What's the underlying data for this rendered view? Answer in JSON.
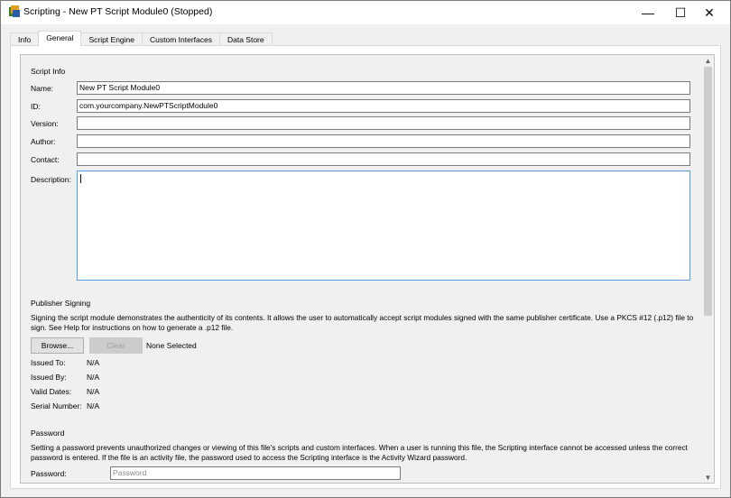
{
  "window": {
    "title": "Scripting - New PT Script Module0 (Stopped)",
    "controls": {
      "minimize": "—",
      "maximize": "☐",
      "close": "✕"
    }
  },
  "tabs": [
    {
      "label": "Info",
      "active": false
    },
    {
      "label": "General",
      "active": true
    },
    {
      "label": "Script Engine",
      "active": false
    },
    {
      "label": "Custom Interfaces",
      "active": false
    },
    {
      "label": "Data Store",
      "active": false
    }
  ],
  "script_info": {
    "heading": "Script Info",
    "name": {
      "label": "Name:",
      "value": "New PT Script Module0"
    },
    "id": {
      "label": "ID:",
      "value": "com.yourcompany.NewPTScriptModule0"
    },
    "version": {
      "label": "Version:",
      "value": ""
    },
    "author": {
      "label": "Author:",
      "value": ""
    },
    "contact": {
      "label": "Contact:",
      "value": ""
    },
    "description": {
      "label": "Description:",
      "value": ""
    }
  },
  "publisher_signing": {
    "heading": "Publisher Signing",
    "text": "Signing the script module demonstrates the authenticity of its contents. It allows the user to automatically accept script modules signed with the same publisher certificate. Use a PKCS #12 (.p12) file to sign. See Help for instructions on how to generate a .p12 file.",
    "browse_label": "Browse...",
    "clear_label": "Clear",
    "selected_text": "None Selected",
    "issued_to": {
      "label": "Issued To:",
      "value": "N/A"
    },
    "issued_by": {
      "label": "Issued By:",
      "value": "N/A"
    },
    "valid_dates": {
      "label": "Valid Dates:",
      "value": "N/A"
    },
    "serial_number": {
      "label": "Serial Number:",
      "value": "N/A"
    }
  },
  "password": {
    "heading": "Password",
    "text": "Setting a password prevents unauthorized changes or viewing of this file's scripts and custom interfaces. When a user is running this file, the Scripting interface cannot be accessed unless the correct password is entered.  If the file is an activity file, the password used to access the Scripting interface is the Activity Wizard password.",
    "label": "Password:",
    "placeholder": "Password",
    "value": ""
  }
}
